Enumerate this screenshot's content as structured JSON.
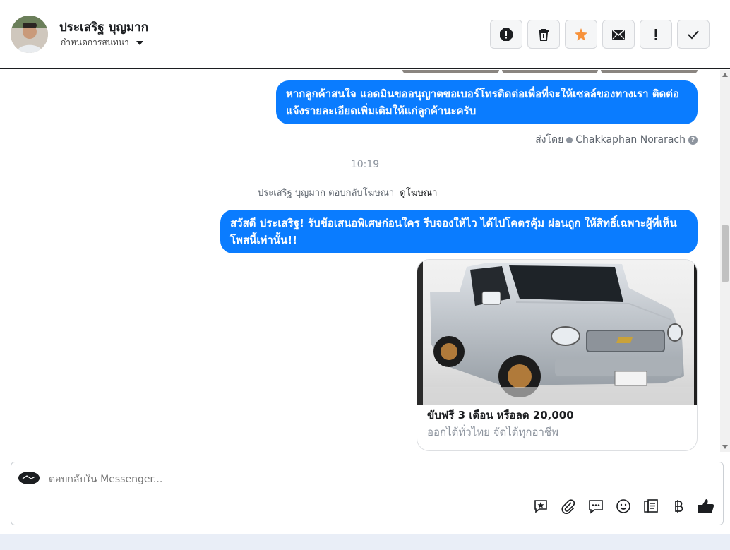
{
  "header": {
    "contact_name": "ประเสริฐ บุญมาก",
    "assign_label": "กำหนดการสนทนา",
    "actions": [
      {
        "name": "spam-icon"
      },
      {
        "name": "trash-icon"
      },
      {
        "name": "star-icon"
      },
      {
        "name": "mail-icon"
      },
      {
        "name": "exclamation-icon"
      },
      {
        "name": "check-icon"
      }
    ]
  },
  "conversation": {
    "msg1": "หากลูกค้าสนใจ แอดมินขออนุญาตขอเบอร์โทรติดต่อเพื่อที่จะให้เซลล์ของทางเรา ติดต่อแจ้งรายละเอียดเพิ่มเติมให้แก่ลูกค้านะครับ",
    "sent_by_label": "ส่งโดย",
    "sent_by_name": "Chakkaphan Norarach",
    "time": "10:19",
    "ad_reply_text": "ประเสริฐ บุญมาก ตอบกลับโฆษณา",
    "ad_link": "ดูโฆษณา",
    "msg2": "สวัสดี ประเสริฐ! รับข้อเสนอพิเศษก่อนใคร รีบจองให้ไว ได้ไปโคตรคุ้ม ผ่อนถูก ให้สิทธิ์เฉพาะผู้ที่เห็นโพสนี้เท่านั้น!!",
    "card_title": "ขับฟรี 3 เดือน หรือลด 20,000",
    "card_subtitle": "ออกได้ทั่วไทย จัดได้ทุกอาชีพ"
  },
  "composer": {
    "placeholder": "ตอบกลับใน Messenger...",
    "tools": [
      "saved-reply-icon",
      "attach-icon",
      "chat-icon",
      "emoji-icon",
      "catalog-icon",
      "baht-icon",
      "thumbs-up-icon"
    ]
  },
  "colors": {
    "bubble": "#0a7cff",
    "star": "#f7923b"
  }
}
